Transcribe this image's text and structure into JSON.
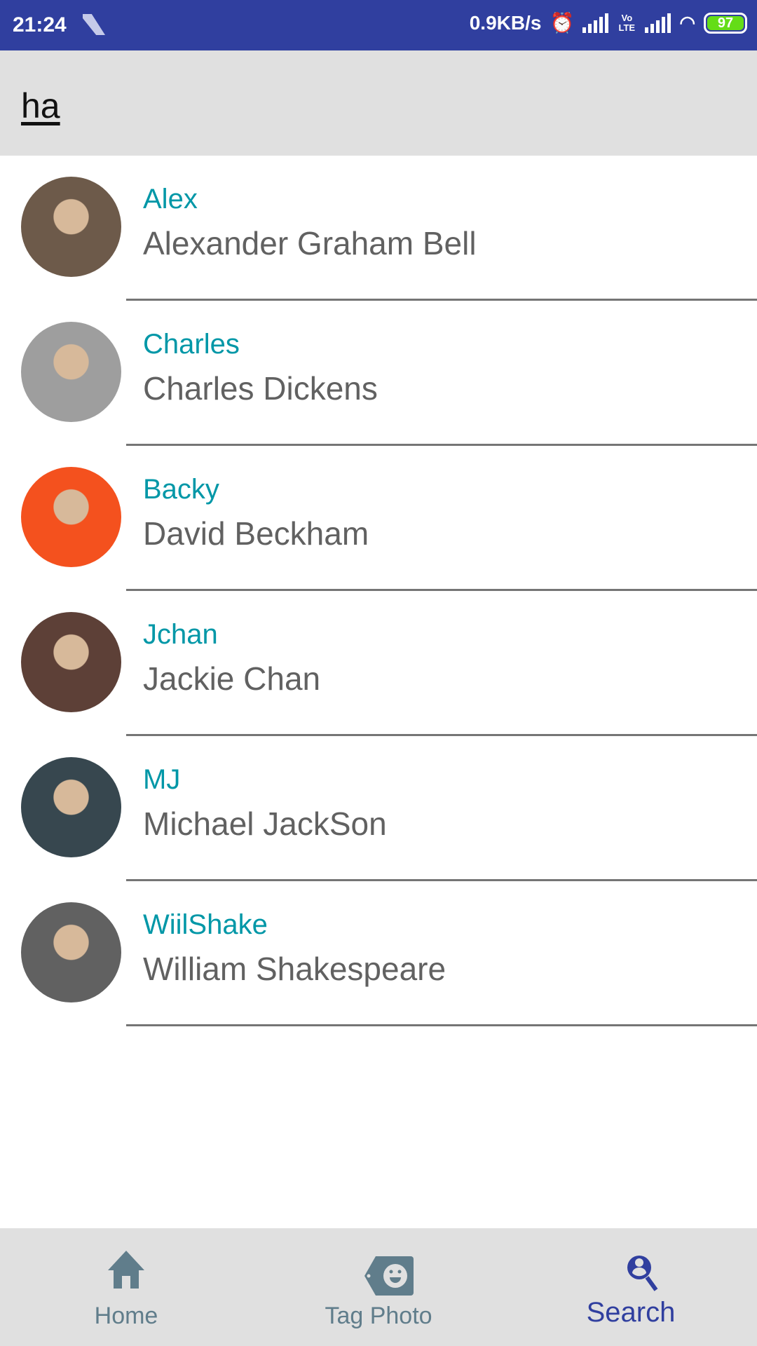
{
  "status_bar": {
    "time": "21:24",
    "network_speed": "0.9KB/s",
    "volte": "Vo LTE",
    "battery": "97"
  },
  "search": {
    "query": "ha"
  },
  "results": [
    {
      "nickname": "Alex",
      "full_name": "Alexander Graham Bell",
      "avatar_color": "#6d5a4a"
    },
    {
      "nickname": "Charles",
      "full_name": "Charles Dickens",
      "avatar_color": "#9e9e9e"
    },
    {
      "nickname": "Backy",
      "full_name": "David Beckham",
      "avatar_color": "#f4511e"
    },
    {
      "nickname": "Jchan",
      "full_name": "Jackie Chan",
      "avatar_color": "#5d4037"
    },
    {
      "nickname": "MJ",
      "full_name": "Michael JackSon",
      "avatar_color": "#37474f"
    },
    {
      "nickname": "WiilShake",
      "full_name": "William Shakespeare",
      "avatar_color": "#616161"
    }
  ],
  "bottom_nav": {
    "items": [
      {
        "label": "Home",
        "icon": "home-icon"
      },
      {
        "label": "Tag Photo",
        "icon": "tag-face-icon"
      },
      {
        "label": "Search",
        "icon": "person-search-icon",
        "active": true
      }
    ]
  },
  "colors": {
    "primary": "#303f9f",
    "accent": "#0097a7",
    "inactive": "#607d8b"
  }
}
